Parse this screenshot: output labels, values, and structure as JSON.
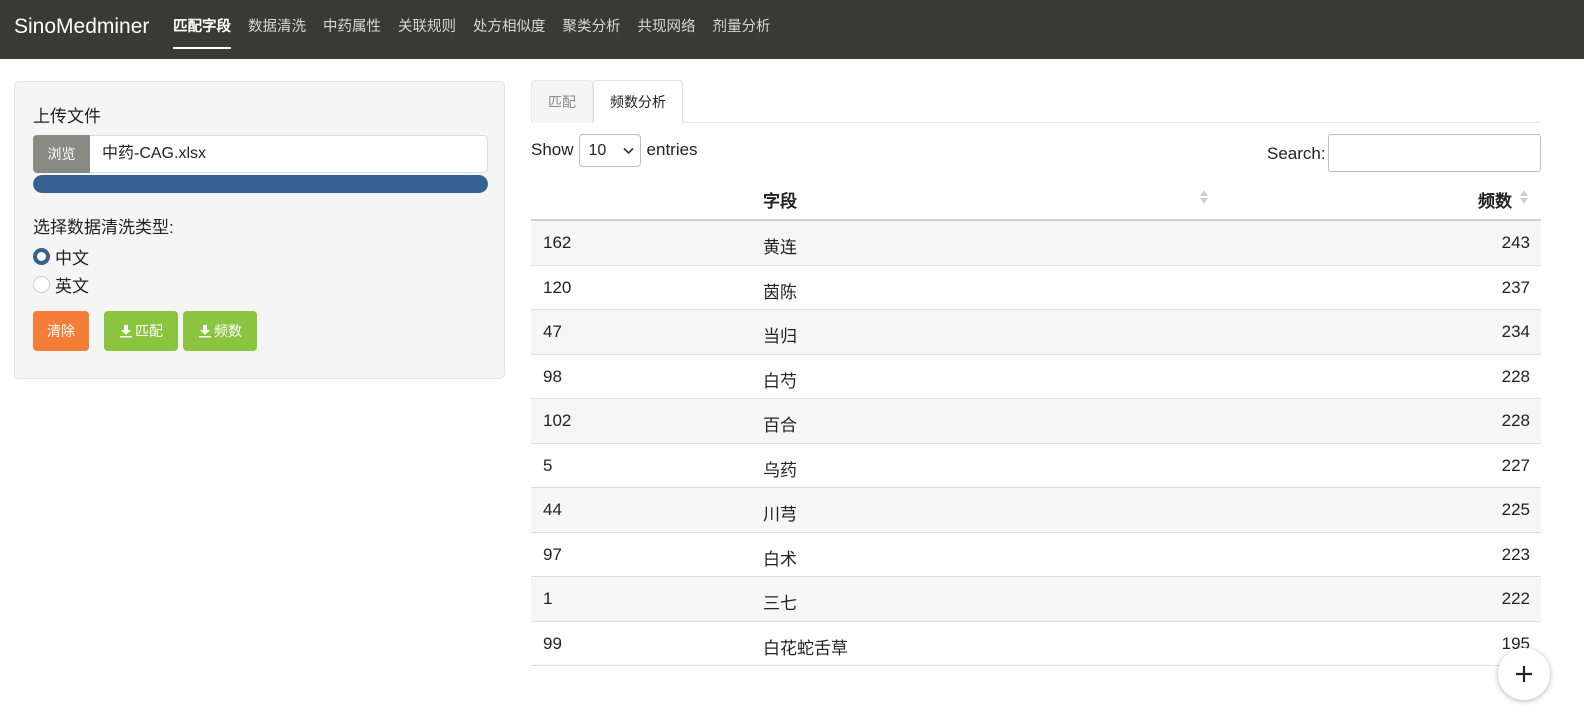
{
  "navbar": {
    "brand": "SinoMedminer",
    "items": [
      {
        "label": "匹配字段",
        "active": true
      },
      {
        "label": "数据清洗"
      },
      {
        "label": "中药属性"
      },
      {
        "label": "关联规则"
      },
      {
        "label": "处方相似度"
      },
      {
        "label": "聚类分析"
      },
      {
        "label": "共现网络"
      },
      {
        "label": "剂量分析"
      }
    ]
  },
  "sidebar": {
    "upload_label": "上传文件",
    "browse_label": "浏览",
    "file_name": "中药-CAG.xlsx",
    "upload_progress": 1.0,
    "clean_type_label": "选择数据清洗类型:",
    "options": [
      {
        "label": "中文",
        "checked": true
      },
      {
        "label": "英文",
        "checked": false
      }
    ],
    "clear_button": "清除",
    "download_match_button": "匹配",
    "download_freq_button": "频数"
  },
  "tabs": [
    {
      "label": "匹配",
      "active": false
    },
    {
      "label": "频数分析",
      "active": true
    }
  ],
  "table_controls": {
    "show_label": "Show",
    "entries_value": "10",
    "entries_label": "entries",
    "search_label": "Search:",
    "search_value": ""
  },
  "table": {
    "columns": [
      "",
      "字段",
      "频数"
    ],
    "rows": [
      {
        "idx": "162",
        "name": "黄连",
        "freq": "243"
      },
      {
        "idx": "120",
        "name": "茵陈",
        "freq": "237"
      },
      {
        "idx": "47",
        "name": "当归",
        "freq": "234"
      },
      {
        "idx": "98",
        "name": "白芍",
        "freq": "228"
      },
      {
        "idx": "102",
        "name": "百合",
        "freq": "228"
      },
      {
        "idx": "5",
        "name": "乌药",
        "freq": "227"
      },
      {
        "idx": "44",
        "name": "川芎",
        "freq": "225"
      },
      {
        "idx": "97",
        "name": "白术",
        "freq": "223"
      },
      {
        "idx": "1",
        "name": "三七",
        "freq": "222"
      },
      {
        "idx": "99",
        "name": "白花蛇舌草",
        "freq": "195"
      }
    ]
  },
  "colors": {
    "navbar": "#3a3a35",
    "primary": "#346391",
    "clear_button": "#f47d38",
    "download_button": "#8bc53f"
  },
  "fab_icon": "plus-icon"
}
